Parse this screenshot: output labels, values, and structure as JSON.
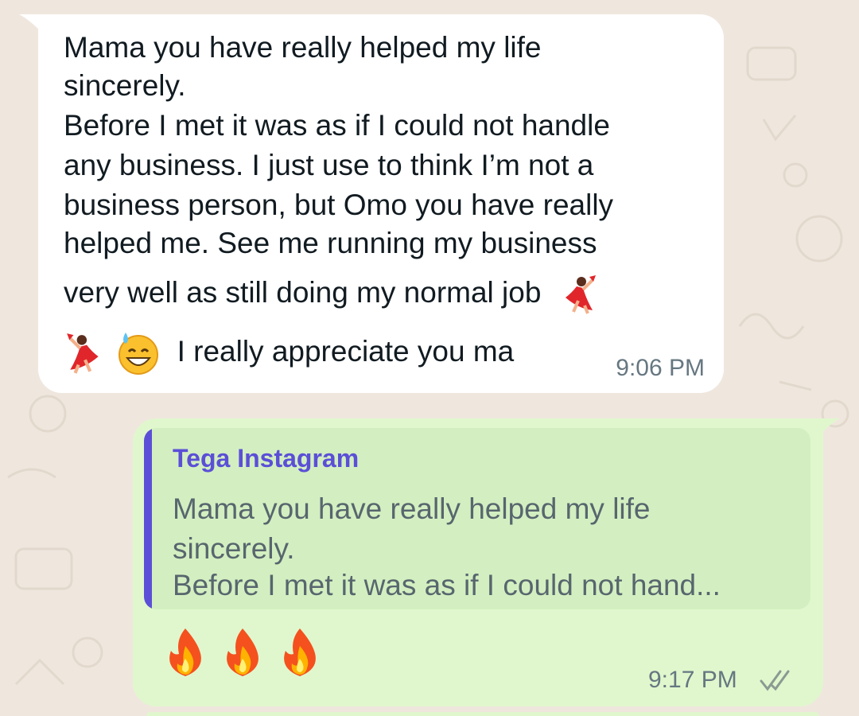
{
  "incoming": {
    "lines": [
      "Mama you have really helped my life",
      "sincerely.",
      "Before I met it was as if I could not handle",
      "any business. I just use to think I’m not a",
      "business person, but Omo you have really",
      "helped me. See me running my business",
      "very well as still doing my normal job",
      "I really appreciate you ma"
    ],
    "emojis": [
      "dancer-emoji",
      "dancer-emoji",
      "sweat-smile-emoji"
    ],
    "time": "9:06 PM"
  },
  "outgoing": {
    "quote": {
      "author": "Tega Instagram",
      "lines": [
        "Mama you have really helped my life",
        "sincerely.",
        "Before I met it was as if I could not hand..."
      ],
      "bar_color": "#5b4fd7"
    },
    "emojis": [
      "fire-emoji",
      "fire-emoji",
      "fire-emoji"
    ],
    "time": "9:17 PM",
    "status_icon": "double-check-icon"
  },
  "colors": {
    "background": "#efe7de",
    "incoming_bubble": "#ffffff",
    "outgoing_bubble": "#e0f7cd",
    "quote_background": "#d3efc1",
    "timestamp": "#667781"
  }
}
